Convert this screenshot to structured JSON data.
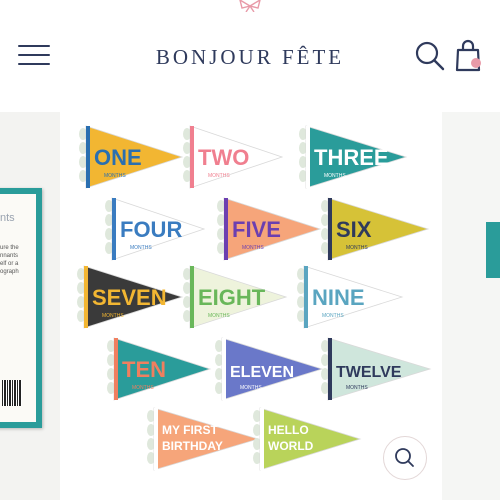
{
  "header": {
    "brand": "BONJOUR FÊTE",
    "menu_icon": "hamburger-menu-icon",
    "search_icon": "search-icon",
    "cart_icon": "shopping-bag-icon"
  },
  "side_slide": {
    "title": "nts",
    "text": [
      "ure the",
      "nnants",
      "elf or a",
      "ograph"
    ]
  },
  "pennants": [
    {
      "word": "ONE",
      "sub": "MONTHS"
    },
    {
      "word": "TWO",
      "sub": "MONTHS"
    },
    {
      "word": "THREE",
      "sub": "MONTHS"
    },
    {
      "word": "FOUR",
      "sub": "MONTHS"
    },
    {
      "word": "FIVE",
      "sub": "MONTHS"
    },
    {
      "word": "SIX",
      "sub": "MONTHS"
    },
    {
      "word": "SEVEN",
      "sub": "MONTHS"
    },
    {
      "word": "EIGHT",
      "sub": "MONTHS"
    },
    {
      "word": "NINE",
      "sub": "MONTHS"
    },
    {
      "word": "TEN",
      "sub": "MONTHS"
    },
    {
      "word": "ELEVEN",
      "sub": "MONTHS"
    },
    {
      "word": "TWELVE",
      "sub": "MONTHS"
    },
    {
      "word": "MY FIRST",
      "word2": "BIRTHDAY",
      "sub": ""
    },
    {
      "word": "HELLO",
      "word2": "WORLD",
      "sub": ""
    }
  ],
  "colors": {
    "brand": "#2f3a5c",
    "accent_pink": "#e89aa8",
    "teal": "#2a9c9a"
  },
  "zoom_icon": "zoom-in-icon"
}
